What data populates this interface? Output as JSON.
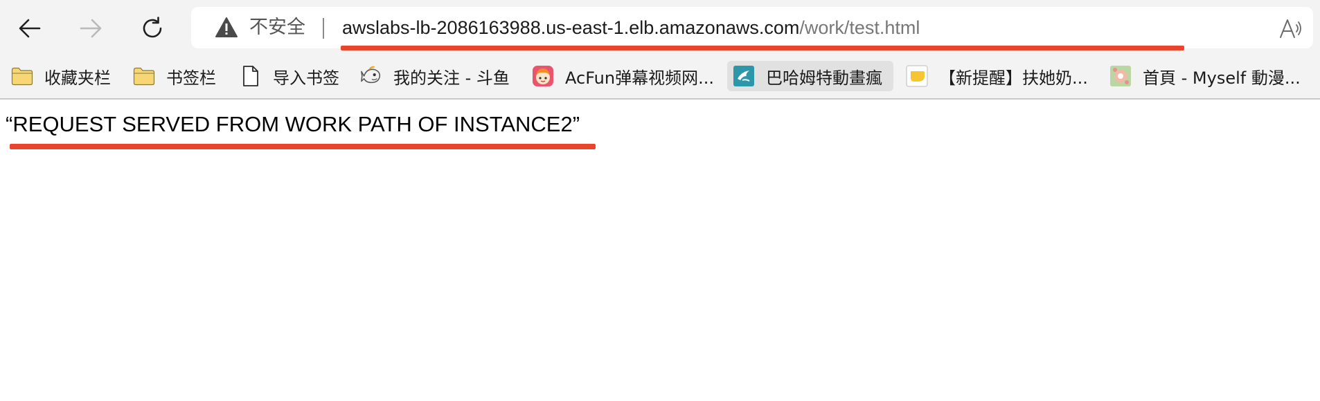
{
  "browser": {
    "address_bar": {
      "security_label": "不安全",
      "url_host": "awslabs-lb-2086163988.us-east-1.elb.amazonaws.com",
      "url_path": "/work/test.html"
    },
    "icons": {
      "back": "back-arrow-icon",
      "forward": "forward-arrow-icon",
      "reload": "reload-icon",
      "security": "warning-triangle-icon",
      "read_aloud": "read-aloud-icon"
    }
  },
  "bookmarks": {
    "items": [
      {
        "label": "收藏夹栏",
        "icon": "folder-icon"
      },
      {
        "label": "书签栏",
        "icon": "folder-icon"
      },
      {
        "label": "导入书签",
        "icon": "page-icon"
      },
      {
        "label": "我的关注 - 斗鱼",
        "icon": "douyu-icon"
      },
      {
        "label": "AcFun弹幕视频网...",
        "icon": "acfun-icon"
      },
      {
        "label": "巴哈姆特動畫瘋",
        "icon": "bahamut-icon"
      },
      {
        "label": "【新提醒】扶她奶...",
        "icon": "forum-icon"
      },
      {
        "label": "首頁 - Myself 動漫...",
        "icon": "myself-icon"
      }
    ]
  },
  "page": {
    "text": "“REQUEST SERVED FROM WORK PATH OF INSTANCE2”"
  },
  "colors": {
    "annotation_red": "#e8452c",
    "chrome_bg": "#f3f3f3",
    "folder_yellow": "#f7d774"
  }
}
